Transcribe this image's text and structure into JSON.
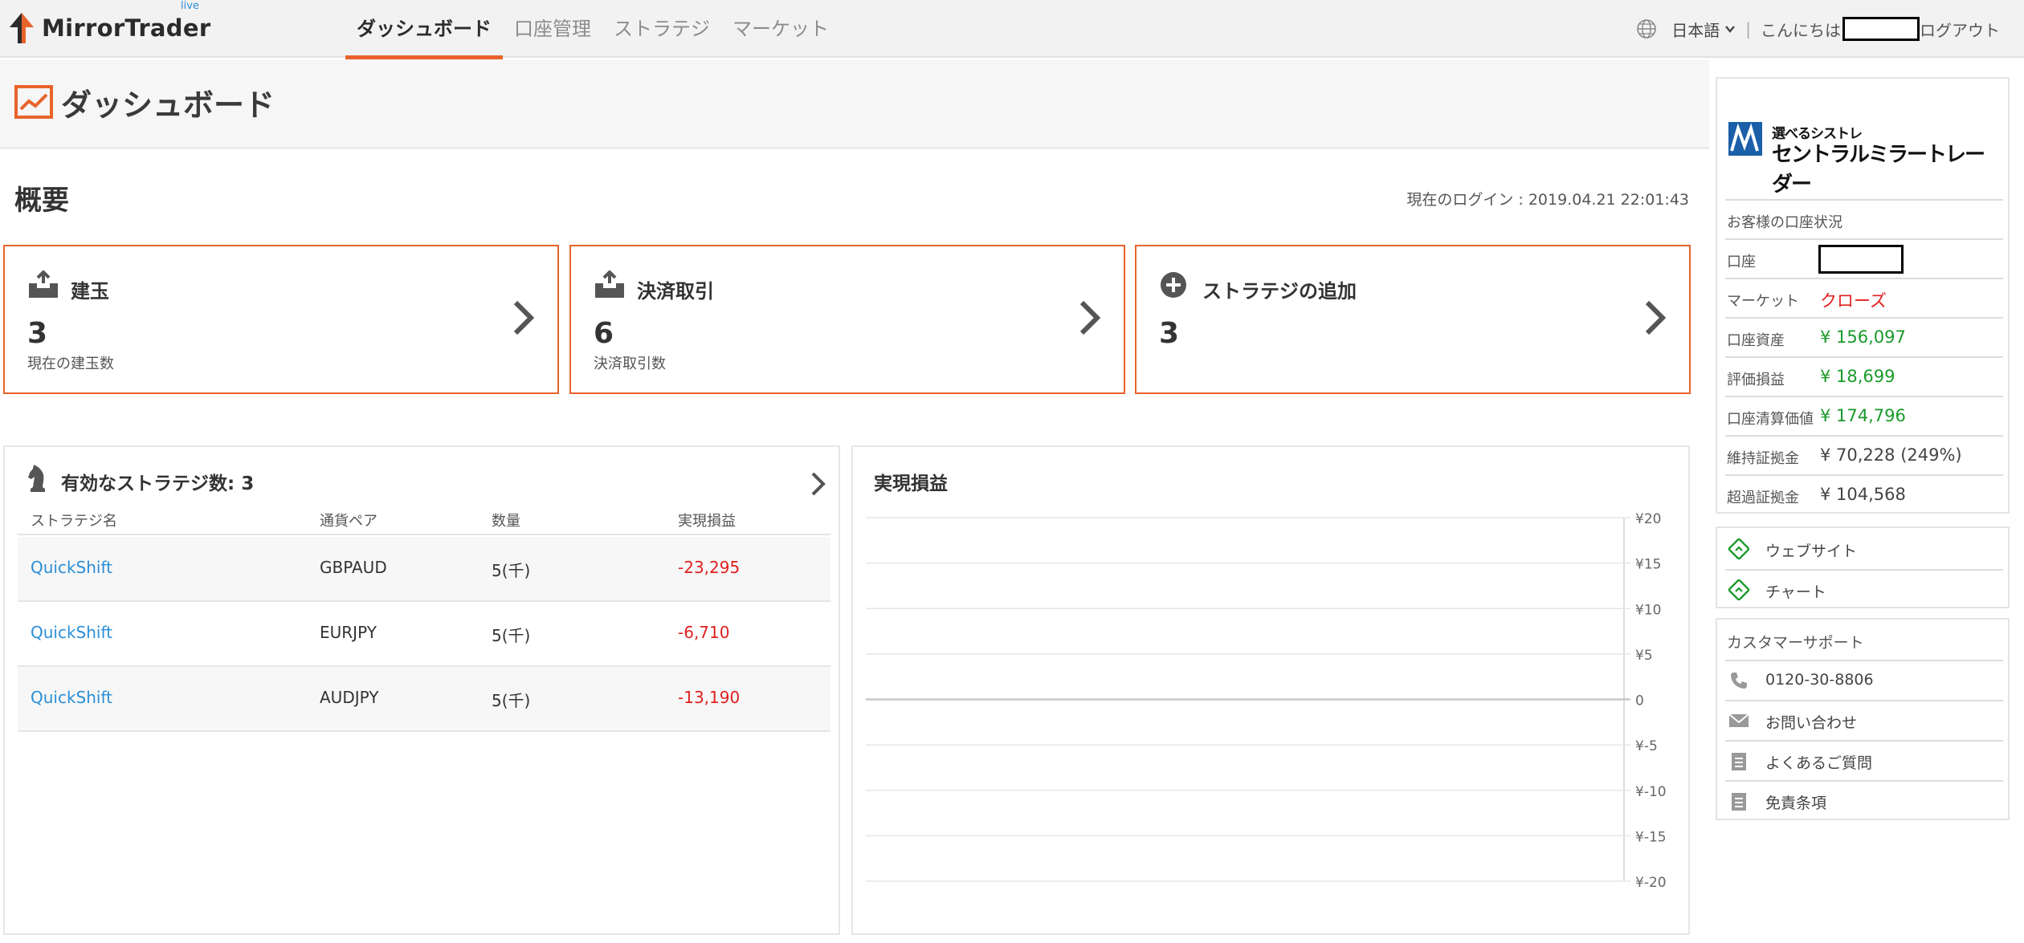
{
  "header": {
    "brand": "MirrorTrader",
    "brand_tag": "live",
    "nav": [
      "ダッシュボード",
      "口座管理",
      "ストラテジ",
      "マーケット"
    ],
    "language": "日本語",
    "greeting": "こんにちは",
    "logout": "ログアウト",
    "separator": "|"
  },
  "page": {
    "title": "ダッシュボード"
  },
  "overview": {
    "title": "概要",
    "last_login": "現在のログイン : 2019.04.21 22:01:43",
    "cards": [
      {
        "title": "建玉",
        "count": "3",
        "sub": "現在の建玉数",
        "icon": "inbox-icon"
      },
      {
        "title": "決済取引",
        "count": "6",
        "sub": "決済取引数",
        "icon": "inbox-icon"
      },
      {
        "title": "ストラテジの追加",
        "count": "3",
        "sub": "",
        "icon": "plus-circle-icon"
      }
    ]
  },
  "strategies": {
    "title": "有効なストラテジ数: 3",
    "columns": [
      "ストラテジ名",
      "通貨ペア",
      "数量",
      "実現損益"
    ],
    "rows": [
      {
        "name": "QuickShift",
        "pair": "GBPAUD",
        "qty": "5(千)",
        "pl": "-23,295"
      },
      {
        "name": "QuickShift",
        "pair": "EURJPY",
        "qty": "5(千)",
        "pl": "-6,710"
      },
      {
        "name": "QuickShift",
        "pair": "AUDJPY",
        "qty": "5(千)",
        "pl": "-13,190"
      }
    ]
  },
  "chart_data": {
    "type": "line",
    "title": "実現損益",
    "xlabel": "",
    "ylabel": "",
    "y_ticks": [
      "¥20",
      "¥15",
      "¥10",
      "¥5",
      "0",
      "¥-5",
      "¥-10",
      "¥-15",
      "¥-20"
    ],
    "ylim": [
      -20,
      20
    ],
    "series": [],
    "grid": true
  },
  "account": {
    "brand_small": "選べるシストレ",
    "brand_big": "セントラルミラートレーダー",
    "status_title": "お客様の口座状況",
    "rows": [
      {
        "label": "口座",
        "value": ""
      },
      {
        "label": "マーケット",
        "value": "クローズ"
      },
      {
        "label": "口座資産",
        "value": "¥ 156,097"
      },
      {
        "label": "評価損益",
        "value": "¥ 18,699"
      },
      {
        "label": "口座清算価値",
        "value": "¥ 174,796"
      },
      {
        "label": "維持証拠金",
        "value": "¥ 70,228 (249%)"
      },
      {
        "label": "超過証拠金",
        "value": "¥ 104,568"
      }
    ]
  },
  "links": {
    "website": "ウェブサイト",
    "chart": "チャート"
  },
  "support": {
    "title": "カスタマーサポート",
    "phone": "0120-30-8806",
    "contact": "お問い合わせ",
    "faq": "よくあるご質問",
    "disclaimer": "免責条項"
  },
  "colors": {
    "accent": "#e8632b",
    "link": "#2b8fd6",
    "negative": "#e02020",
    "positive": "#1a9a2a"
  }
}
